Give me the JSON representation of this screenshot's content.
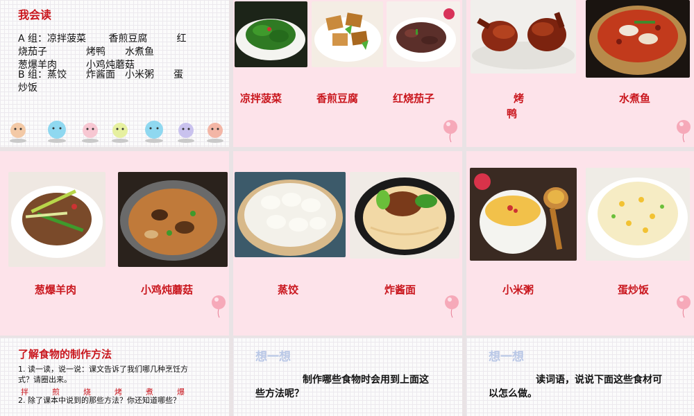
{
  "slide1": {
    "title": "我会读",
    "line1": "A 组：凉拌菠菜　　 香煎豆腐　　　红",
    "line2": "烧茄子　　　　烤鸭　　水煮鱼",
    "line3": "葱爆羊肉　　　小鸡炖蘑菇",
    "line4": "B 组：蒸饺　　炸酱面　小米粥　　蛋",
    "line5": "炒饭"
  },
  "slide2": {
    "labels": [
      "凉拌菠菜",
      "香煎豆腐",
      "红烧茄子"
    ]
  },
  "slide3": {
    "label_a1": "烤",
    "label_a2": "鸭",
    "label_b": "水煮鱼"
  },
  "slide4": {
    "labels": [
      "葱爆羊肉",
      "小鸡炖蘑菇"
    ]
  },
  "slide5": {
    "labels": [
      "蒸饺",
      "炸酱面"
    ]
  },
  "slide6": {
    "labels": [
      "小米粥",
      "蛋炒饭"
    ]
  },
  "slide7": {
    "title": "了解食物的制作方法",
    "q1a": "1. 读一读，说一说：课文告诉了我们哪几种烹饪方",
    "q1b": "式？请圈出来。",
    "methods": [
      "拌",
      "煎",
      "烧",
      "烤",
      "煮",
      "爆"
    ],
    "q2": "2. 除了课本中说到的那些方法？你还知道哪些？"
  },
  "slide8": {
    "title": "想一想",
    "text1": "制作哪些食物时会用到上面这",
    "text2": "些方法呢？"
  },
  "slide9": {
    "title": "想一想",
    "text1": "读词语，说说下面这些食材可",
    "text2": "以怎么做。"
  }
}
